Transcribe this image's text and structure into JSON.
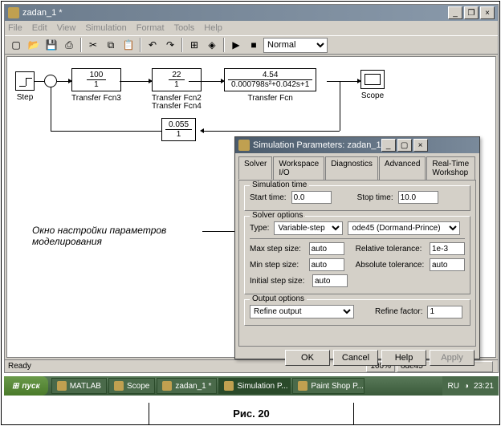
{
  "window": {
    "title": "zadan_1 *",
    "menu": [
      "File",
      "Edit",
      "View",
      "Simulation",
      "Format",
      "Tools",
      "Help"
    ],
    "mode_select": "Normal",
    "status_ready": "Ready",
    "status_zoom": "100%",
    "status_solver": "ode45"
  },
  "blocks": {
    "step_label": "Step",
    "tf3": {
      "num": "100",
      "den": "1",
      "label": "Transfer Fcn3"
    },
    "tf2": {
      "num": "22",
      "den": "1",
      "label": "Transfer Fcn2",
      "label2": "Transfer Fcn4"
    },
    "tf": {
      "num": "4.54",
      "den": "0.000798s²+0.042s+1",
      "label": "Transfer Fcn"
    },
    "fb": {
      "num": "0.055",
      "den": "1"
    },
    "scope_label": "Scope"
  },
  "annotation": "Окно настройки параметров моделирования",
  "dialog": {
    "title": "Simulation Parameters: zadan_1",
    "tabs": [
      "Solver",
      "Workspace I/O",
      "Diagnostics",
      "Advanced",
      "Real-Time Workshop"
    ],
    "sim_time_label": "Simulation time",
    "start_label": "Start time:",
    "start_val": "0.0",
    "stop_label": "Stop time:",
    "stop_val": "10.0",
    "solver_opts_label": "Solver options",
    "type_label": "Type:",
    "type_val": "Variable-step",
    "solver_val": "ode45 (Dormand-Prince)",
    "max_label": "Max step size:",
    "max_val": "auto",
    "min_label": "Min step size:",
    "min_val": "auto",
    "init_label": "Initial step size:",
    "init_val": "auto",
    "reltol_label": "Relative tolerance:",
    "reltol_val": "1e-3",
    "abstol_label": "Absolute tolerance:",
    "abstol_val": "auto",
    "output_label": "Output options",
    "output_val": "Refine output",
    "refine_label": "Refine factor:",
    "refine_val": "1",
    "btn_ok": "OK",
    "btn_cancel": "Cancel",
    "btn_help": "Help",
    "btn_apply": "Apply"
  },
  "taskbar": {
    "start": "пуск",
    "items": [
      "MATLAB",
      "Scope",
      "zadan_1 *",
      "Simulation P...",
      "Paint Shop P..."
    ],
    "lang": "RU",
    "time": "23:21"
  },
  "caption": "Рис. 20"
}
